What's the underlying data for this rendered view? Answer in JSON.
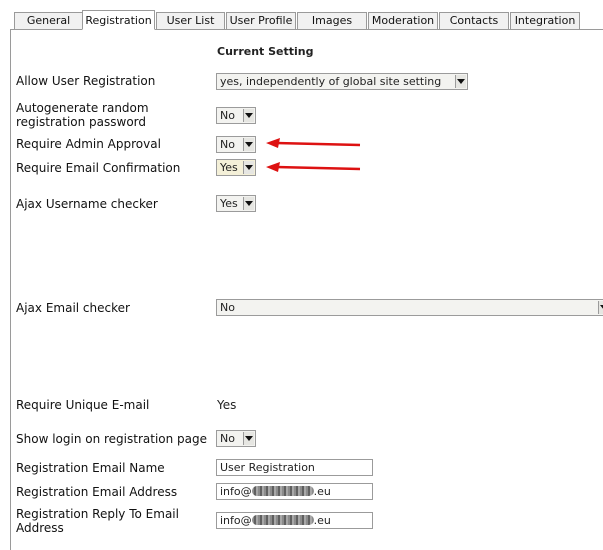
{
  "tabs": [
    {
      "label": "General"
    },
    {
      "label": "Registration"
    },
    {
      "label": "User List"
    },
    {
      "label": "User Profile"
    },
    {
      "label": "Images"
    },
    {
      "label": "Moderation"
    },
    {
      "label": "Contacts"
    },
    {
      "label": "Integration"
    }
  ],
  "active_tab": "Registration",
  "column_header": "Current Setting",
  "settings": {
    "allow_registration": {
      "label": "Allow User Registration",
      "value": "yes, independently of global site setting"
    },
    "autogen_password": {
      "label": "Autogenerate random registration password",
      "value": "No"
    },
    "admin_approval": {
      "label": "Require Admin Approval",
      "value": "No"
    },
    "email_confirmation": {
      "label": "Require Email Confirmation",
      "value": "Yes"
    },
    "ajax_username": {
      "label": "Ajax Username checker",
      "value": "Yes"
    },
    "ajax_email": {
      "label": "Ajax Email checker",
      "value": "No"
    },
    "unique_email": {
      "label": "Require Unique E-mail",
      "value": "Yes"
    },
    "show_login": {
      "label": "Show login on registration page",
      "value": "No"
    },
    "email_name": {
      "label": "Registration Email Name",
      "value": "User Registration"
    },
    "email_address": {
      "label": "Registration Email Address",
      "prefix": "info@",
      "suffix": ".eu"
    },
    "reply_to": {
      "label": "Registration Reply To Email Address",
      "prefix": "info@",
      "suffix": ".eu"
    }
  },
  "annotation_color": "#dd1111"
}
